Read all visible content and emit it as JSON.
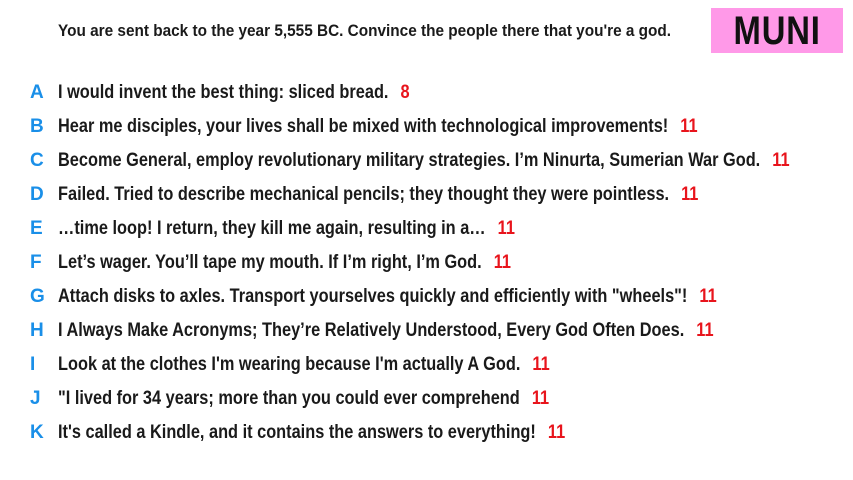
{
  "prompt": "You are sent back to the year 5,555 BC. Convince the people there that you're a god.",
  "badge": {
    "label": "MUNI",
    "color": "#ff99e8"
  },
  "colors": {
    "letter": "#1a8fe8",
    "score": "#e8141c",
    "text": "#1a1a1a"
  },
  "answers": [
    {
      "letter": "A",
      "text": "I would invent the best thing: sliced bread.",
      "score": "8"
    },
    {
      "letter": "B",
      "text": "Hear me disciples, your lives shall be mixed with technological improvements!",
      "score": "11"
    },
    {
      "letter": "C",
      "text": "Become General, employ revolutionary military strategies. I’m Ninurta, Sumerian War God.",
      "score": "11"
    },
    {
      "letter": "D",
      "text": "Failed. Tried to describe mechanical pencils; they thought they were pointless.",
      "score": "11"
    },
    {
      "letter": "E",
      "text": "…time loop! I return, they kill me again, resulting in a…",
      "score": "11"
    },
    {
      "letter": "F",
      "text": "Let’s wager. You’ll tape my mouth. If I’m right, I’m God.",
      "score": "11"
    },
    {
      "letter": "G",
      "text": "Attach disks to axles. Transport yourselves quickly and efficiently with \"wheels\"!",
      "score": "11"
    },
    {
      "letter": "H",
      "text": "I Always Make Acronyms; They’re Relatively Understood, Every God Often Does.",
      "score": "11"
    },
    {
      "letter": "I",
      "text": "Look at the clothes I'm wearing because I'm actually A God.",
      "score": "11"
    },
    {
      "letter": "J",
      "text": "\"I lived for 34 years; more than you could ever comprehend",
      "score": "11"
    },
    {
      "letter": "K",
      "text": "It's called a Kindle, and it contains the answers to everything!",
      "score": "11"
    }
  ]
}
